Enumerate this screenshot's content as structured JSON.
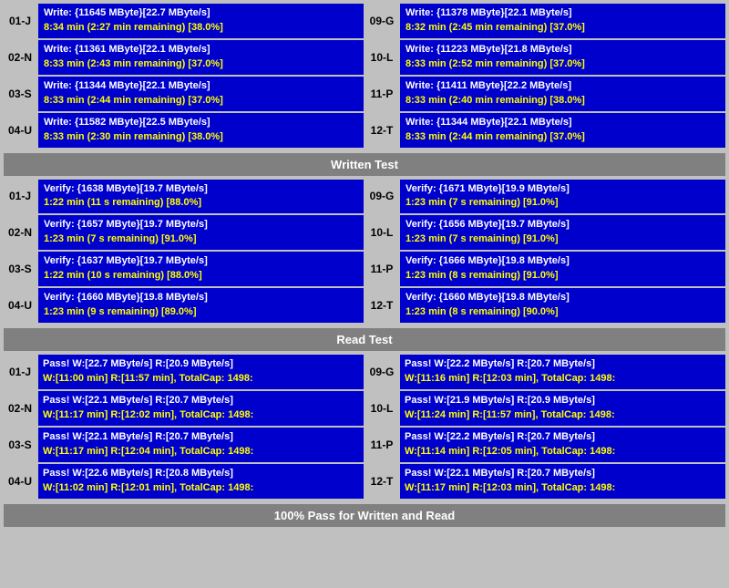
{
  "sections": {
    "write": {
      "rows_left": [
        {
          "id": "01-J",
          "line1": "Write: {11645 MByte}[22.7 MByte/s]",
          "line2": "8:34 min (2:27 min remaining)  [38.0%]"
        },
        {
          "id": "02-N",
          "line1": "Write: {11361 MByte}[22.1 MByte/s]",
          "line2": "8:33 min (2:43 min remaining)  [37.0%]"
        },
        {
          "id": "03-S",
          "line1": "Write: {11344 MByte}[22.1 MByte/s]",
          "line2": "8:33 min (2:44 min remaining)  [37.0%]"
        },
        {
          "id": "04-U",
          "line1": "Write: {11582 MByte}[22.5 MByte/s]",
          "line2": "8:33 min (2:30 min remaining)  [38.0%]"
        }
      ],
      "rows_right": [
        {
          "id": "09-G",
          "line1": "Write: {11378 MByte}[22.1 MByte/s]",
          "line2": "8:32 min (2:45 min remaining)  [37.0%]"
        },
        {
          "id": "10-L",
          "line1": "Write: {11223 MByte}[21.8 MByte/s]",
          "line2": "8:33 min (2:52 min remaining)  [37.0%]"
        },
        {
          "id": "11-P",
          "line1": "Write: {11411 MByte}[22.2 MByte/s]",
          "line2": "8:33 min (2:40 min remaining)  [38.0%]"
        },
        {
          "id": "12-T",
          "line1": "Write: {11344 MByte}[22.1 MByte/s]",
          "line2": "8:33 min (2:44 min remaining)  [37.0%]"
        }
      ]
    },
    "written_test_label": "Written Test",
    "verify": {
      "rows_left": [
        {
          "id": "01-J",
          "line1": "Verify: {1638 MByte}[19.7 MByte/s]",
          "line2": "1:22 min (11 s remaining)   [88.0%]"
        },
        {
          "id": "02-N",
          "line1": "Verify: {1657 MByte}[19.7 MByte/s]",
          "line2": "1:23 min (7 s remaining)   [91.0%]"
        },
        {
          "id": "03-S",
          "line1": "Verify: {1637 MByte}[19.7 MByte/s]",
          "line2": "1:22 min (10 s remaining)   [88.0%]"
        },
        {
          "id": "04-U",
          "line1": "Verify: {1660 MByte}[19.8 MByte/s]",
          "line2": "1:23 min (9 s remaining)   [89.0%]"
        }
      ],
      "rows_right": [
        {
          "id": "09-G",
          "line1": "Verify: {1671 MByte}[19.9 MByte/s]",
          "line2": "1:23 min (7 s remaining)   [91.0%]"
        },
        {
          "id": "10-L",
          "line1": "Verify: {1656 MByte}[19.7 MByte/s]",
          "line2": "1:23 min (7 s remaining)   [91.0%]"
        },
        {
          "id": "11-P",
          "line1": "Verify: {1666 MByte}[19.8 MByte/s]",
          "line2": "1:23 min (8 s remaining)   [91.0%]"
        },
        {
          "id": "12-T",
          "line1": "Verify: {1660 MByte}[19.8 MByte/s]",
          "line2": "1:23 min (8 s remaining)   [90.0%]"
        }
      ]
    },
    "read_test_label": "Read Test",
    "read": {
      "rows_left": [
        {
          "id": "01-J",
          "line1": "Pass! W:[22.7 MByte/s] R:[20.9 MByte/s]",
          "line2": " W:[11:00 min] R:[11:57 min], TotalCap: 1498:"
        },
        {
          "id": "02-N",
          "line1": "Pass! W:[22.1 MByte/s] R:[20.7 MByte/s]",
          "line2": " W:[11:17 min] R:[12:02 min], TotalCap: 1498:"
        },
        {
          "id": "03-S",
          "line1": "Pass! W:[22.1 MByte/s] R:[20.7 MByte/s]",
          "line2": " W:[11:17 min] R:[12:04 min], TotalCap: 1498:"
        },
        {
          "id": "04-U",
          "line1": "Pass! W:[22.6 MByte/s] R:[20.8 MByte/s]",
          "line2": " W:[11:02 min] R:[12:01 min], TotalCap: 1498:"
        }
      ],
      "rows_right": [
        {
          "id": "09-G",
          "line1": "Pass! W:[22.2 MByte/s] R:[20.7 MByte/s]",
          "line2": " W:[11:16 min] R:[12:03 min], TotalCap: 1498:"
        },
        {
          "id": "10-L",
          "line1": "Pass! W:[21.9 MByte/s] R:[20.9 MByte/s]",
          "line2": " W:[11:24 min] R:[11:57 min], TotalCap: 1498:"
        },
        {
          "id": "11-P",
          "line1": "Pass! W:[22.2 MByte/s] R:[20.7 MByte/s]",
          "line2": " W:[11:14 min] R:[12:05 min], TotalCap: 1498:"
        },
        {
          "id": "12-T",
          "line1": "Pass! W:[22.1 MByte/s] R:[20.7 MByte/s]",
          "line2": " W:[11:17 min] R:[12:03 min], TotalCap: 1498:"
        }
      ]
    },
    "footer_label": "100% Pass for Written and Read"
  }
}
